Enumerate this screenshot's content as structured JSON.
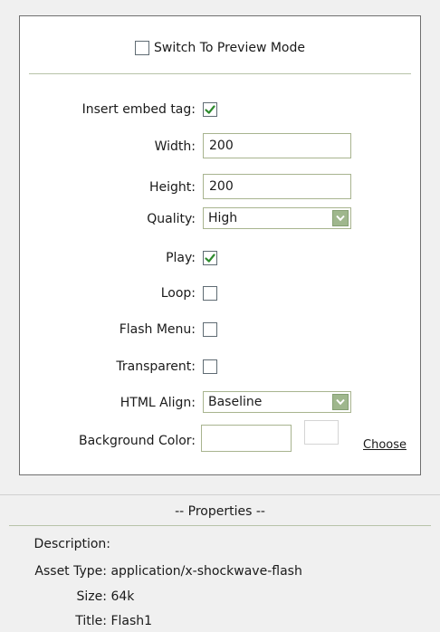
{
  "preview": {
    "label": "Switch To Preview Mode",
    "checked": false
  },
  "fields": {
    "embed": {
      "label": "Insert embed tag:",
      "checked": true
    },
    "width": {
      "label": "Width:",
      "value": "200"
    },
    "height": {
      "label": "Height:",
      "value": "200"
    },
    "quality": {
      "label": "Quality:",
      "value": "High"
    },
    "play": {
      "label": "Play:",
      "checked": true
    },
    "loop": {
      "label": "Loop:",
      "checked": false
    },
    "flash_menu": {
      "label": "Flash Menu:",
      "checked": false
    },
    "transparent": {
      "label": "Transparent:",
      "checked": false
    },
    "html_align": {
      "label": "HTML Align:",
      "value": "Baseline"
    },
    "background_color": {
      "label": "Background Color:",
      "value": "",
      "choose_label": "Choose"
    }
  },
  "properties": {
    "header": "-- Properties --",
    "description": {
      "key": "Description:",
      "value": ""
    },
    "asset_type": {
      "key": "Asset Type:",
      "value": "application/x-shockwave-flash"
    },
    "size": {
      "key": "Size:",
      "value": "64k"
    },
    "title": {
      "key": "Title:",
      "value": "Flash1"
    }
  },
  "colors": {
    "check_mark": "#2e8b2e",
    "field_border": "#a8b48f",
    "dropdown_button": "#9fb78d"
  },
  "icons": {
    "check": "check-icon",
    "dropdown": "chevron-down-icon"
  }
}
